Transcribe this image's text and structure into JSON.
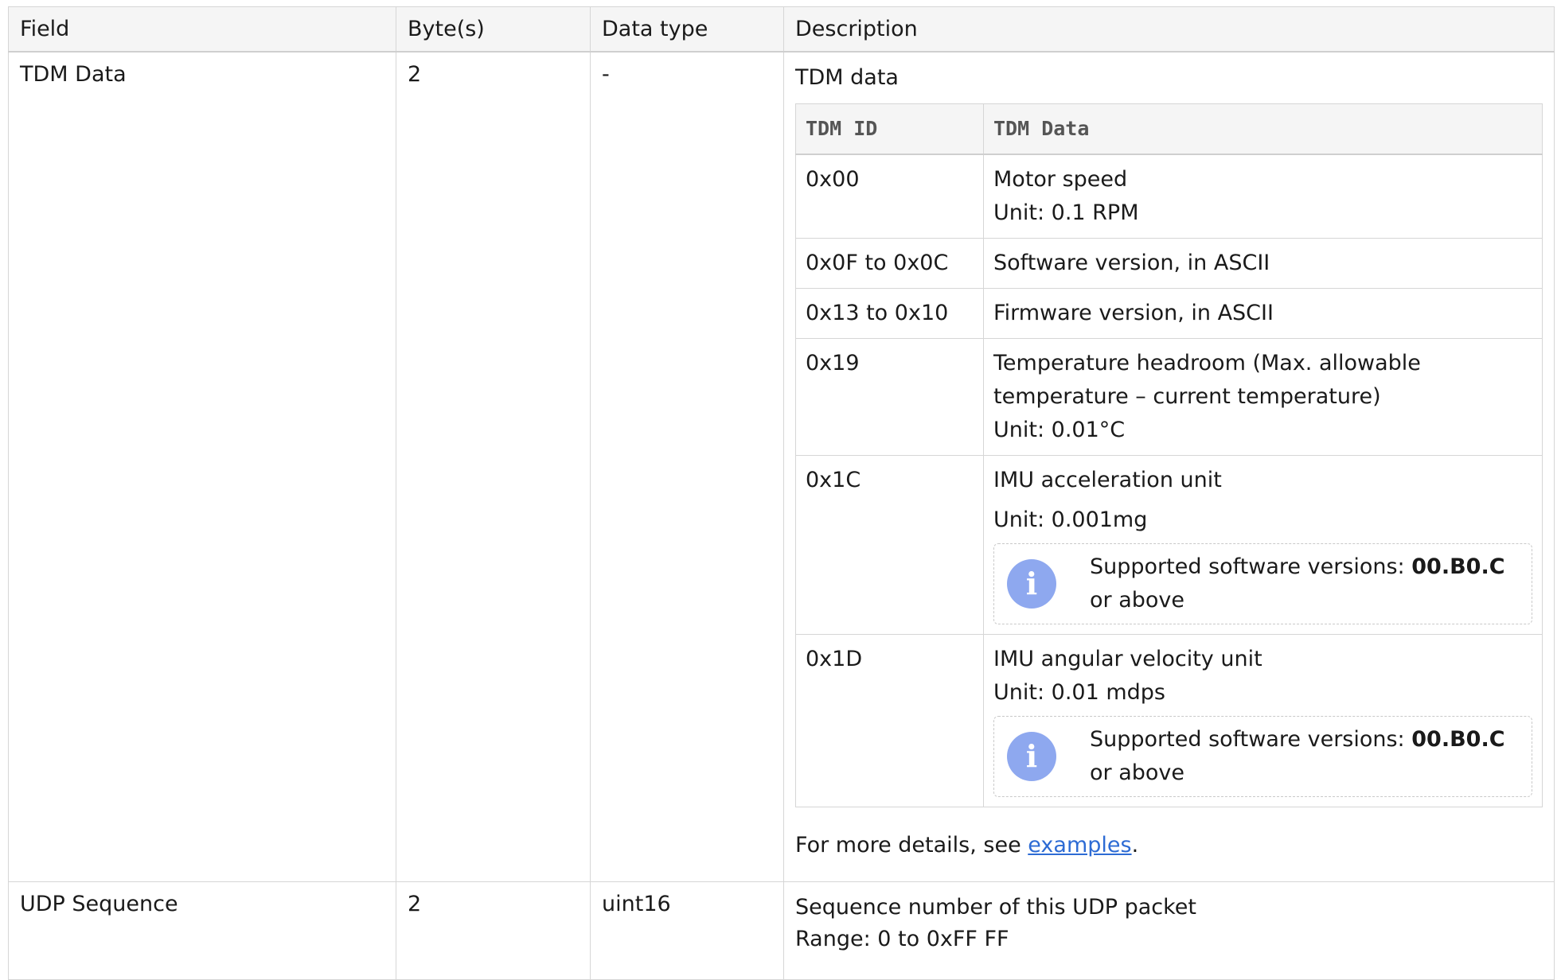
{
  "columns": {
    "field": "Field",
    "bytes": "Byte(s)",
    "data_type": "Data type",
    "description": "Description"
  },
  "rows": [
    {
      "field": "TDM Data",
      "bytes": "2",
      "data_type": "-",
      "description_intro": "TDM data",
      "inner_table": {
        "headers": [
          "TDM ID",
          "TDM Data"
        ],
        "rows": [
          {
            "id": "0x00",
            "lines": [
              "Motor speed",
              "Unit: 0.1 RPM"
            ]
          },
          {
            "id": "0x0F to 0x0C",
            "lines": [
              "Software version, in ASCII"
            ]
          },
          {
            "id": "0x13 to 0x10",
            "lines": [
              "Firmware version, in ASCII"
            ]
          },
          {
            "id": "0x19",
            "lines": [
              "Temperature headroom (Max. allowable temperature – current temperature)",
              "Unit: 0.01°C"
            ]
          },
          {
            "id": "0x1C",
            "lines": [
              "IMU acceleration unit",
              "Unit: 0.001mg"
            ],
            "note": {
              "prefix": "Supported software versions: ",
              "version": "00.B0.C",
              "suffix": " or above"
            }
          },
          {
            "id": "0x1D",
            "lines": [
              "IMU angular velocity unit",
              "Unit: 0.01 mdps"
            ],
            "note": {
              "prefix": "Supported software versions: ",
              "version": "00.B0.C",
              "suffix": " or above"
            }
          }
        ]
      },
      "footer_prefix": "For more details, see ",
      "footer_link": "examples",
      "footer_suffix": "."
    },
    {
      "field": "UDP Sequence",
      "bytes": "2",
      "data_type": "uint16",
      "description_lines": [
        "Sequence number of this UDP packet",
        "Range: 0 to 0xFF FF"
      ]
    }
  ],
  "icons": {
    "note_icon": "info-icon",
    "note_icon_color": "#8ea8ef",
    "link_color": "#2d6bd4"
  }
}
